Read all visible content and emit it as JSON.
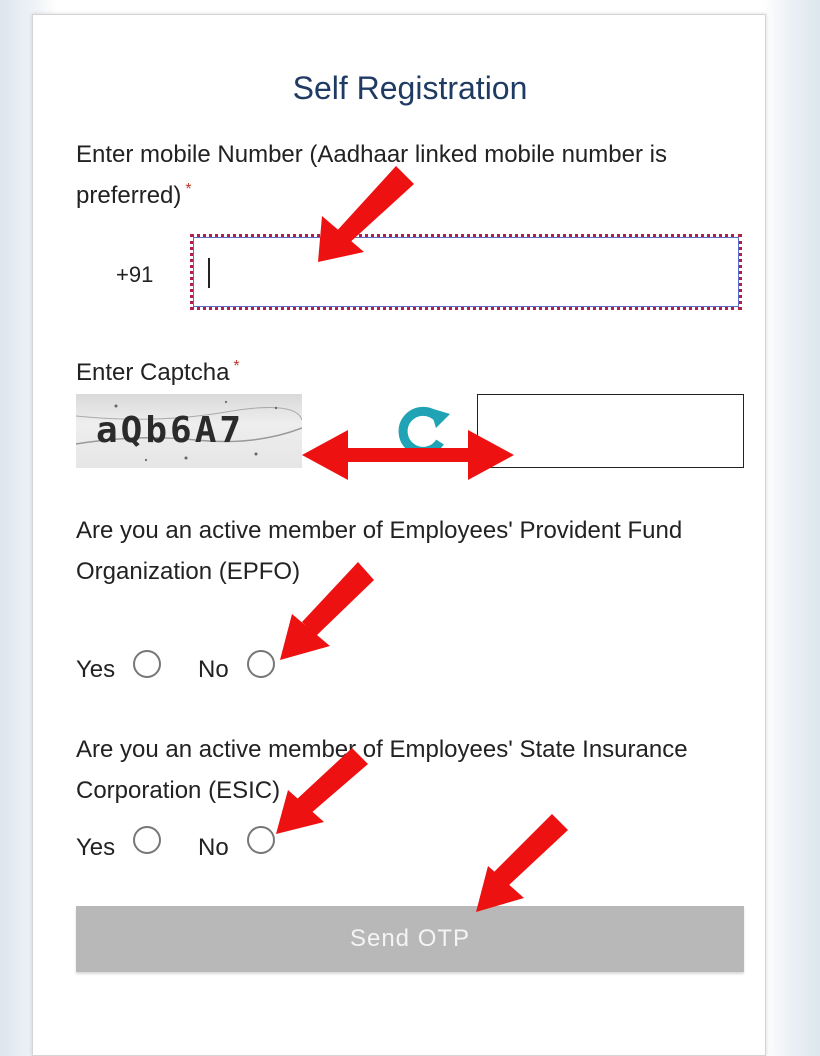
{
  "form": {
    "title": "Self Registration",
    "mobile": {
      "label": "Enter mobile Number (Aadhaar linked mobile number is preferred)",
      "required_mark": "*",
      "prefix": "+91",
      "value": ""
    },
    "captcha": {
      "label": "Enter Captcha",
      "required_mark": "*",
      "image_text": "aQb6A7",
      "refresh_icon": "refresh-icon",
      "value": ""
    },
    "epfo": {
      "question": "Are you an active member of Employees' Provident Fund Organization (EPFO)",
      "yes_label": "Yes",
      "no_label": "No"
    },
    "esic": {
      "question": "Are you an active member of Employees' State Insurance Corporation (ESIC)",
      "yes_label": "Yes",
      "no_label": "No"
    },
    "send_button_label": "Send OTP"
  },
  "colors": {
    "title": "#1f3b63",
    "required": "#c0392b",
    "button_disabled": "#b8b8b8",
    "refresh": "#1fa3b5",
    "annotation_arrow": "#ee1111"
  }
}
